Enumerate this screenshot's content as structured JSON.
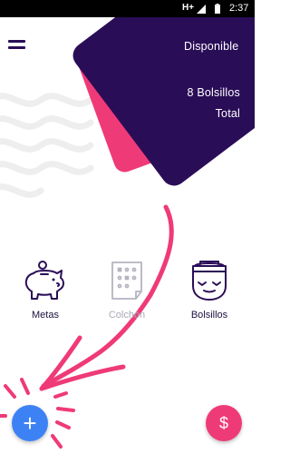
{
  "status_bar": {
    "network": "H+",
    "time": "2:37"
  },
  "card": {
    "available_label": "Disponible",
    "pockets_label": "8 Bolsillos",
    "total_label": "Total"
  },
  "categories": [
    {
      "label": "Metas",
      "icon": "piggy-bank-icon"
    },
    {
      "label": "Colchón",
      "icon": "mattress-icon"
    },
    {
      "label": "Bolsillos",
      "icon": "pocket-icon"
    }
  ],
  "fabs": {
    "add_symbol": "+",
    "money_symbol": "$"
  },
  "colors": {
    "brand_dark": "#2a0d57",
    "accent_pink": "#ef3a78",
    "fab_blue": "#3d82f5"
  }
}
